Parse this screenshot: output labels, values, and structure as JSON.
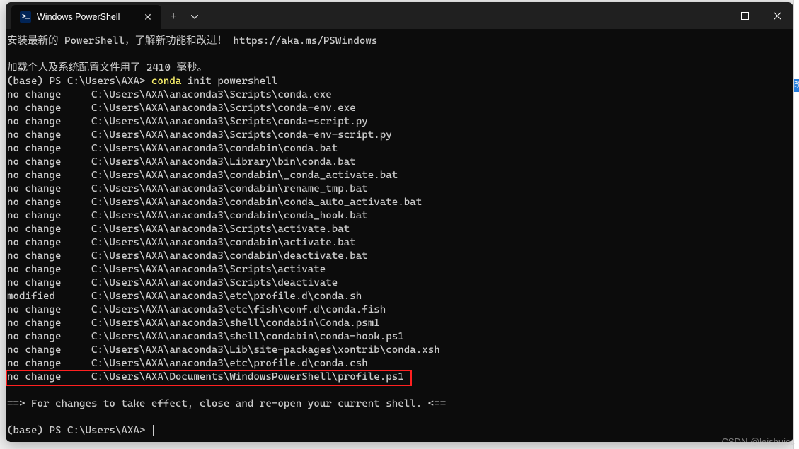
{
  "window": {
    "tab": {
      "title": "Windows PowerShell"
    },
    "controls": {
      "minimize": "Minimize",
      "maximize": "Maximize",
      "close": "Close"
    }
  },
  "terminal": {
    "banner_pre": "安装最新的 PowerShell，了解新功能和改进！",
    "banner_link": "https://aka.ms/PSWindows",
    "profile_load": "加载个人及系统配置文件用了 2410 毫秒。",
    "prompt_prefix": "(base) PS C:\\Users\\AXA> ",
    "command_name": "conda",
    "command_args": " init powershell",
    "lines": [
      "no change     C:\\Users\\AXA\\anaconda3\\Scripts\\conda.exe",
      "no change     C:\\Users\\AXA\\anaconda3\\Scripts\\conda-env.exe",
      "no change     C:\\Users\\AXA\\anaconda3\\Scripts\\conda-script.py",
      "no change     C:\\Users\\AXA\\anaconda3\\Scripts\\conda-env-script.py",
      "no change     C:\\Users\\AXA\\anaconda3\\condabin\\conda.bat",
      "no change     C:\\Users\\AXA\\anaconda3\\Library\\bin\\conda.bat",
      "no change     C:\\Users\\AXA\\anaconda3\\condabin\\_conda_activate.bat",
      "no change     C:\\Users\\AXA\\anaconda3\\condabin\\rename_tmp.bat",
      "no change     C:\\Users\\AXA\\anaconda3\\condabin\\conda_auto_activate.bat",
      "no change     C:\\Users\\AXA\\anaconda3\\condabin\\conda_hook.bat",
      "no change     C:\\Users\\AXA\\anaconda3\\Scripts\\activate.bat",
      "no change     C:\\Users\\AXA\\anaconda3\\condabin\\activate.bat",
      "no change     C:\\Users\\AXA\\anaconda3\\condabin\\deactivate.bat",
      "no change     C:\\Users\\AXA\\anaconda3\\Scripts\\activate",
      "no change     C:\\Users\\AXA\\anaconda3\\Scripts\\deactivate",
      "modified      C:\\Users\\AXA\\anaconda3\\etc\\profile.d\\conda.sh",
      "no change     C:\\Users\\AXA\\anaconda3\\etc\\fish\\conf.d\\conda.fish",
      "no change     C:\\Users\\AXA\\anaconda3\\shell\\condabin\\Conda.psm1",
      "no change     C:\\Users\\AXA\\anaconda3\\shell\\condabin\\conda-hook.ps1",
      "no change     C:\\Users\\AXA\\anaconda3\\Lib\\site-packages\\xontrib\\conda.xsh",
      "no change     C:\\Users\\AXA\\anaconda3\\etc\\profile.d\\conda.csh",
      "no change     C:\\Users\\AXA\\Documents\\WindowsPowerShell\\profile.ps1"
    ],
    "highlighted_line_index": 21,
    "effect_msg": "==> For changes to take effect, close and re-open your current shell. <==",
    "prompt2": "(base) PS C:\\Users\\AXA> "
  },
  "watermark": "CSDN @leishuicc",
  "right_badge": "改"
}
